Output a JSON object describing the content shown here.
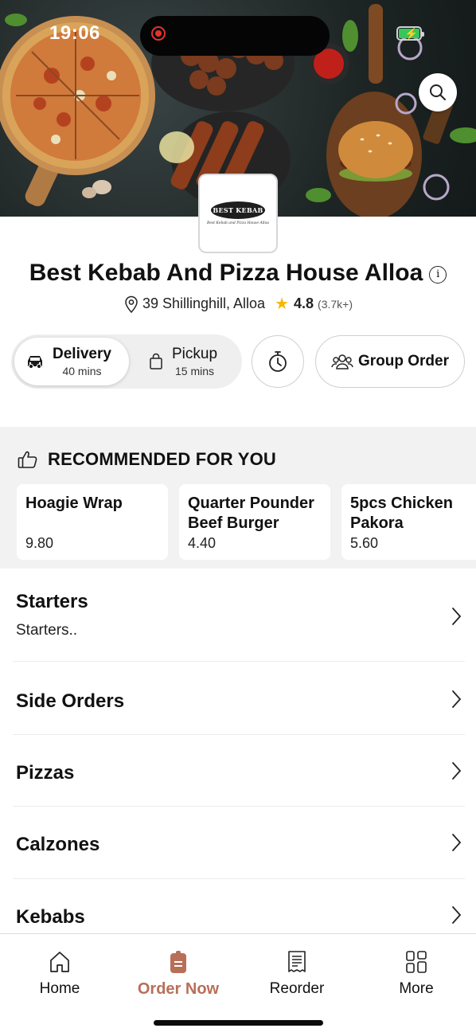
{
  "status_bar": {
    "time": "19:06"
  },
  "hero": {
    "logo": {
      "badge_text": "BEST KEBAB",
      "subtitle": "Best Kebab and Pizza House Alloa"
    },
    "search_icon": "search-icon"
  },
  "store": {
    "name": "Best Kebab And Pizza House Alloa",
    "address": "39 Shillinghill, Alloa",
    "rating": "4.8",
    "rating_count": "(3.7k+)"
  },
  "order_mode": {
    "delivery": {
      "label": "Delivery",
      "time": "40 mins"
    },
    "pickup": {
      "label": "Pickup",
      "time": "15 mins"
    }
  },
  "group_order": {
    "label": "Group Order"
  },
  "recommended": {
    "title": "RECOMMENDED FOR YOU",
    "items": [
      {
        "name": "Hoagie Wrap",
        "price": "9.80"
      },
      {
        "name": "Quarter Pounder Beef Burger",
        "price": "4.40"
      },
      {
        "name": "5pcs Chicken Pakora",
        "price": "5.60"
      }
    ]
  },
  "categories": [
    {
      "name": "Starters",
      "subtitle": "Starters.."
    },
    {
      "name": "Side Orders"
    },
    {
      "name": "Pizzas"
    },
    {
      "name": "Calzones"
    },
    {
      "name": "Kebabs"
    }
  ],
  "bottom_nav": {
    "active": "Order Now",
    "items": [
      {
        "label": "Home",
        "icon": "home-icon"
      },
      {
        "label": "Order Now",
        "icon": "order-icon"
      },
      {
        "label": "Reorder",
        "icon": "receipt-icon"
      },
      {
        "label": "More",
        "icon": "grid-icon"
      }
    ]
  },
  "colors": {
    "accent": "#b86f58",
    "star": "#f5b700",
    "battery": "#34c759",
    "recording": "#e4332c"
  }
}
